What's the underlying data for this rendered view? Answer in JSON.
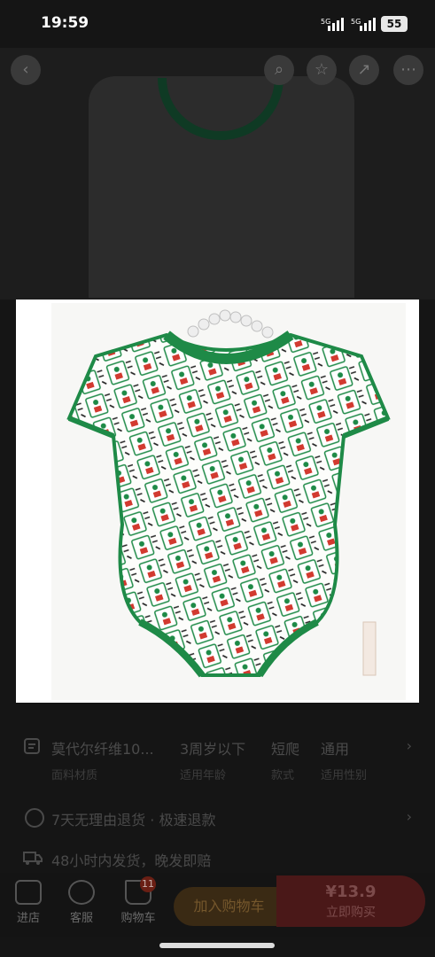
{
  "status_bar": {
    "time": "19:59",
    "net1": "5G",
    "net2": "5G",
    "battery": "55"
  },
  "gallery": {
    "image_alt": "mahjong print baby bodysuit"
  },
  "specs": [
    {
      "value": "莫代尔纤维10...",
      "label": "面料材质"
    },
    {
      "value": "3周岁以下",
      "label": "适用年龄"
    },
    {
      "value": "短爬",
      "label": "款式"
    },
    {
      "value": "通用",
      "label": "适用性别"
    }
  ],
  "services": [
    {
      "text": "7天无理由退货 · 极速退款"
    },
    {
      "text": "48小时内发货，晚发即赔"
    }
  ],
  "bottom_bar": {
    "shop": "进店",
    "service": "客服",
    "cart": "购物车",
    "cart_badge": "11",
    "add_to_cart": "加入购物车",
    "price": "¥13.9",
    "buy_now": "立即购买"
  },
  "colors": {
    "accent_red": "#e8322b",
    "garment_green": "#1e8a47"
  }
}
